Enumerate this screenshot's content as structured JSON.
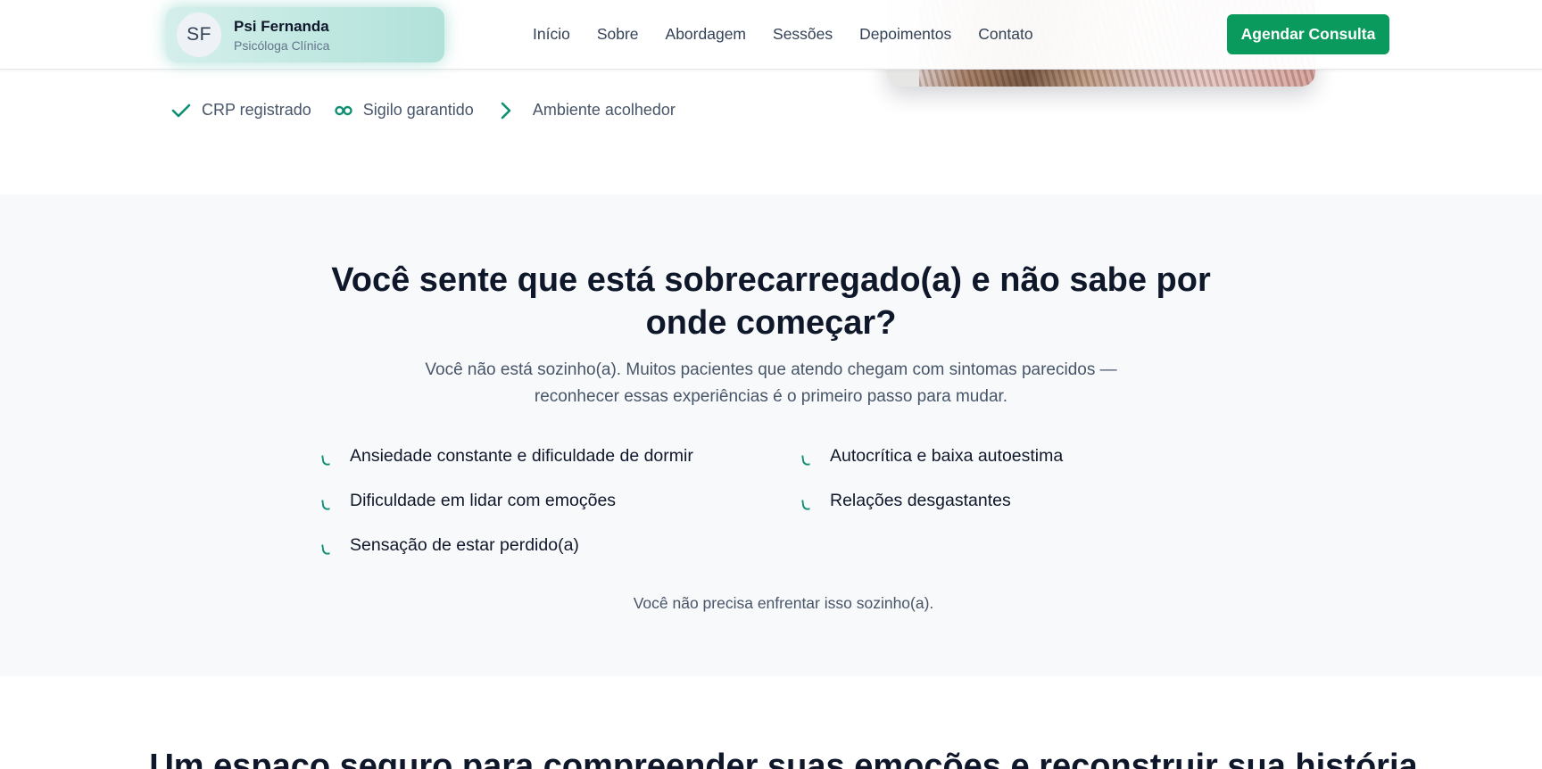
{
  "header": {
    "avatar_initials": "SF",
    "brand_name": "Psi Fernanda",
    "brand_role": "Psicóloga Clínica",
    "nav": [
      "Início",
      "Sobre",
      "Abordagem",
      "Sessões",
      "Depoimentos",
      "Contato"
    ],
    "cta_label": "Agendar Consulta"
  },
  "trust": [
    {
      "icon": "check-icon",
      "label": "CRP registrado"
    },
    {
      "icon": "infinity-icon",
      "label": "Sigilo garantido"
    },
    {
      "icon": "chevron-right-icon",
      "label": "Ambiente acolhedor"
    }
  ],
  "pain": {
    "title": "Você sente que está sobrecarregado(a) e não sabe por onde começar?",
    "subtitle": "Você não está sozinho(a). Muitos pacientes que atendo chegam com sintomas parecidos — reconhecer essas experiências é o primeiro passo para mudar.",
    "items": [
      "Ansiedade constante e dificuldade de dormir",
      "Autocrítica e baixa autoestima",
      "Dificuldade em lidar com emoções",
      "Relações desgastantes",
      "Sensação de estar perdido(a)"
    ],
    "note": "Você não precisa enfrentar isso sozinho(a)."
  },
  "next_section": {
    "title": "Um espaço seguro para compreender suas emoções e reconstruir sua história"
  },
  "colors": {
    "accent": "#0b9a5d",
    "teal": "#0f8f74",
    "section_bg": "#f8f9fa",
    "text": "#0f172a",
    "muted": "#475569"
  }
}
